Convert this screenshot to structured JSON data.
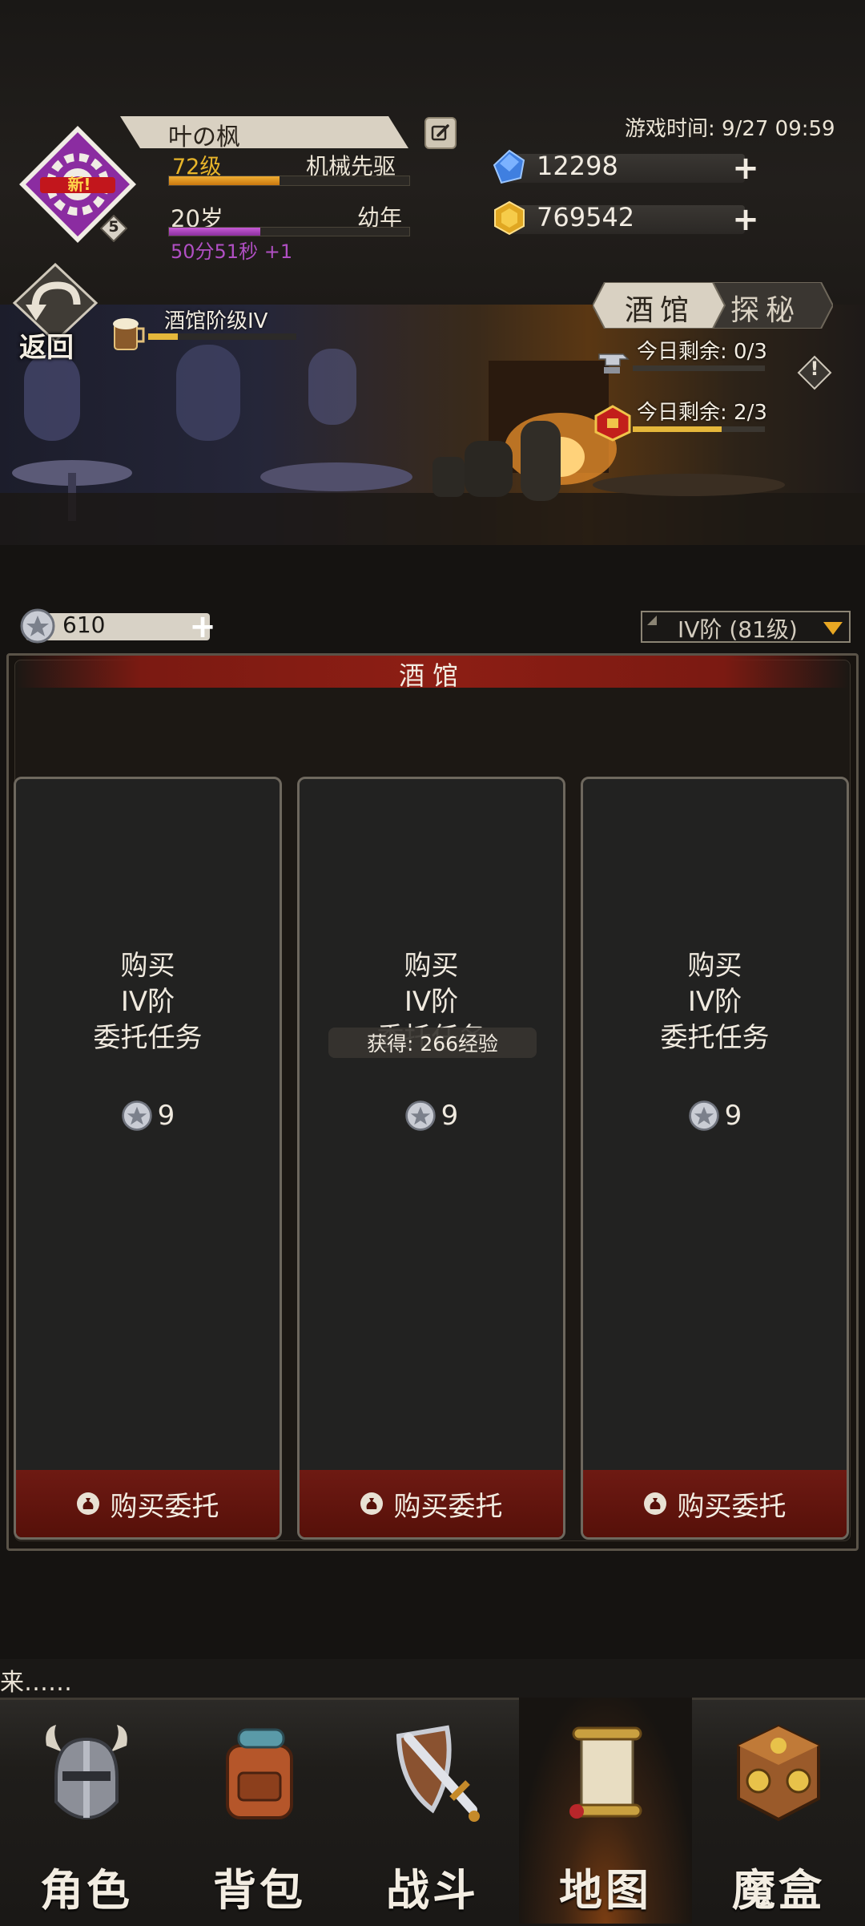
{
  "player": {
    "name": "叶の枫",
    "level": "72级",
    "class": "机械先驱",
    "xp_fraction": 0.46,
    "age": "20岁",
    "stage": "幼年",
    "age_fraction": 0.38,
    "timer": "50分51秒 +1",
    "badge_level": "5",
    "avatar_badge": "新!"
  },
  "header": {
    "game_time": "游戏时间: 9/27 09:59",
    "gems": "12298",
    "gold": "769542"
  },
  "scene": {
    "back_label": "返回",
    "tavern_level": "酒馆阶级IV",
    "tab_tavern": "酒馆",
    "tab_explore": "探秘",
    "remain_1": "今日剩余: 0/3",
    "remain_1_fraction": 0.0,
    "remain_2": "今日剩余: 2/3",
    "remain_2_fraction": 0.67,
    "info_icon": "!"
  },
  "tickets": {
    "count": "610",
    "tier_select": "IV阶 (81级)"
  },
  "panel": {
    "title": "酒馆",
    "toast": "获得: 266经验",
    "cards": [
      {
        "line1": "购买",
        "line2": "IV阶",
        "line3": "委托任务",
        "cost": "9",
        "button": "购买委托"
      },
      {
        "line1": "购买",
        "line2": "IV阶",
        "line3": "委托任务",
        "cost": "9",
        "button": "购买委托"
      },
      {
        "line1": "购买",
        "line2": "IV阶",
        "line3": "委托任务",
        "cost": "9",
        "button": "购买委托"
      }
    ]
  },
  "ticker": "来……",
  "nav": [
    {
      "label": "角色",
      "icon": "helmet-icon"
    },
    {
      "label": "背包",
      "icon": "backpack-icon"
    },
    {
      "label": "战斗",
      "icon": "sword-shield-icon"
    },
    {
      "label": "地图",
      "icon": "scroll-map-icon",
      "active": true
    },
    {
      "label": "魔盒",
      "icon": "magic-box-icon"
    }
  ],
  "colors": {
    "accent_gold": "#e8b52a",
    "accent_purple": "#b04fc3",
    "panel_red": "#8d1e14"
  }
}
